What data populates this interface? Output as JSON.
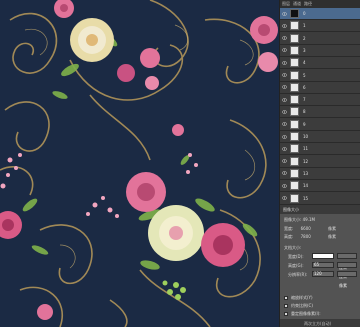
{
  "canvas": {
    "background_color": "#1b2a44",
    "motif_color": "#b99a5a",
    "rose_pink": "#e2739a",
    "rose_cream": "#f1ead0",
    "leaf_green": "#7fb24a"
  },
  "layers_panel": {
    "tabs": [
      "图层",
      "通道",
      "路径"
    ],
    "selected_color": "#4b6a8f",
    "layers": [
      {
        "name": "0",
        "thumb": "dark"
      },
      {
        "name": "1",
        "thumb": "light"
      },
      {
        "name": "2",
        "thumb": "light"
      },
      {
        "name": "3",
        "thumb": "light"
      },
      {
        "name": "4",
        "thumb": "light"
      },
      {
        "name": "5",
        "thumb": "light"
      },
      {
        "name": "6",
        "thumb": "light"
      },
      {
        "name": "7",
        "thumb": "light"
      },
      {
        "name": "8",
        "thumb": "light"
      },
      {
        "name": "9",
        "thumb": "light"
      },
      {
        "name": "10",
        "thumb": "light"
      },
      {
        "name": "11",
        "thumb": "light"
      },
      {
        "name": "12",
        "thumb": "light"
      },
      {
        "name": "13",
        "thumb": "light"
      },
      {
        "name": "14",
        "thumb": "light"
      },
      {
        "name": "15",
        "thumb": "light"
      }
    ]
  },
  "image_size_dialog": {
    "title": "图像大小",
    "image_size": {
      "label": "图像大小:",
      "value": "49.1M"
    },
    "width_px": {
      "label": "宽度:",
      "value": "6600",
      "unit": "像素"
    },
    "height_px": {
      "label": "高度:",
      "value": "7800",
      "unit": "像素"
    },
    "doc_size_label": "文档大小:",
    "doc_width": {
      "label": "宽度(D):",
      "value": "",
      "unit": "厘米"
    },
    "doc_height": {
      "label": "高度(G):",
      "value": "65",
      "unit": "厘米"
    },
    "resolution": {
      "label": "分辨率(R):",
      "value": "120",
      "unit": "像素"
    },
    "scale_styles": "缩放样式(Y)",
    "constrain": "约束比例(C)",
    "resample": "重定图像像素(I):",
    "footer": "两次立方(自动)"
  }
}
